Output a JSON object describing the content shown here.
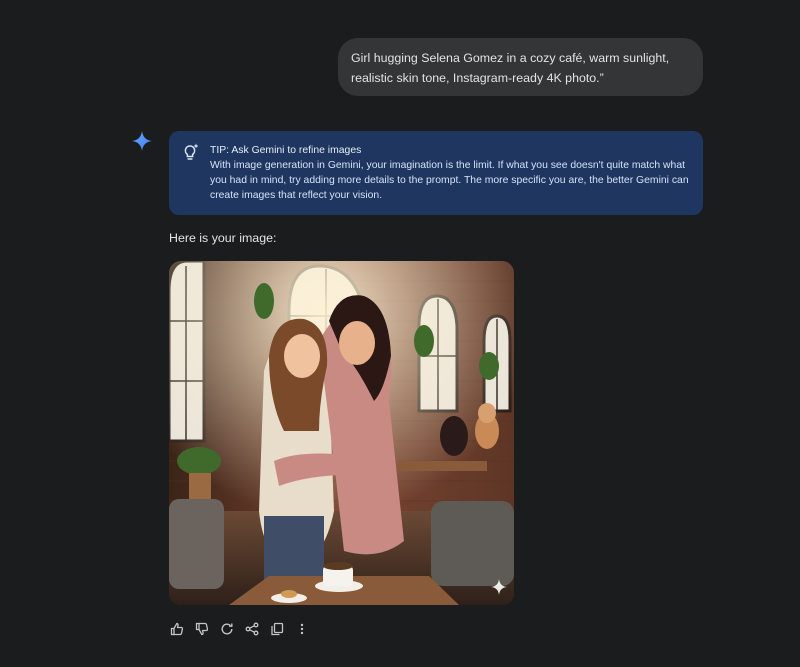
{
  "conversation": {
    "user_prompt": "Girl hugging Selena Gomez in a cozy café, warm sunlight, realistic skin tone, Instagram-ready 4K photo.”",
    "tip": {
      "title": "TIP: Ask Gemini to refine images",
      "body": "With image generation in Gemini, your imagination is the limit. If what you see doesn't quite match what you had in mind, try adding more details to the prompt. The more specific you are, the better Gemini can create images that reflect your vision.",
      "icon": "lightbulb-sparkle-icon"
    },
    "response_intro": "Here is your image:",
    "assistant_icon": "gemini-sparkle-icon",
    "image_watermark_icon": "gemini-sparkle-watermark"
  },
  "actions": [
    {
      "name": "thumbs-up-icon"
    },
    {
      "name": "thumbs-down-icon"
    },
    {
      "name": "regenerate-icon"
    },
    {
      "name": "share-icon"
    },
    {
      "name": "copy-icon"
    },
    {
      "name": "more-options-icon"
    }
  ],
  "colors": {
    "background": "#1b1c1d",
    "user_bubble": "#333537",
    "tip_background": "#1f3760",
    "accent_blue": "#4c8df6"
  }
}
